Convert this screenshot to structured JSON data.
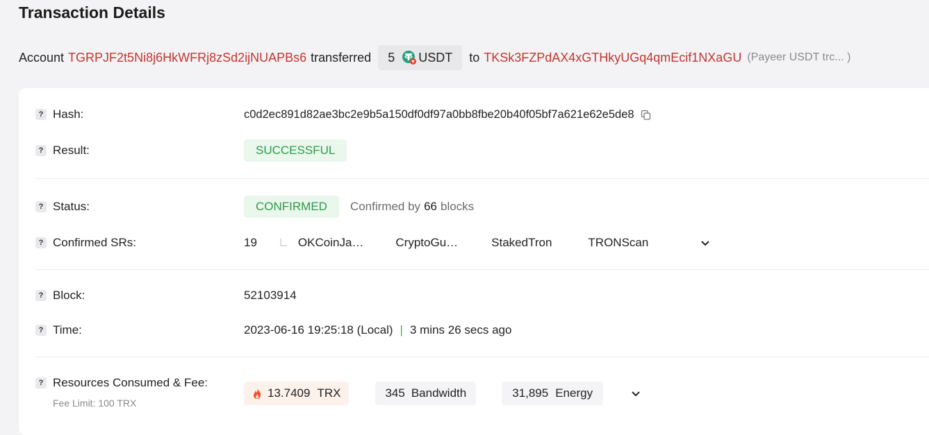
{
  "header": {
    "title": "Transaction Details"
  },
  "summary": {
    "account_label": "Account",
    "from_address": "TGRPJF2t5Ni8j6HkWFRj8zSd2ijNUAPBs6",
    "transferred_label": "transferred",
    "amount": "5",
    "token": "USDT",
    "to_label": "to",
    "to_address": "TKSk3FZPdAX4xGTHkyUGq4qmEcif1NXaGU",
    "to_note": "(Payeer USDT trc... )"
  },
  "details": {
    "hash": {
      "label": "Hash:",
      "value": "c0d2ec891d82ae3bc2e9b5a150df0df97a0bb8fbe20b40f05bf7a621e62e5de8"
    },
    "result": {
      "label": "Result:",
      "value": "SUCCESSFUL"
    },
    "status": {
      "label": "Status:",
      "value": "CONFIRMED",
      "confirmed_prefix": "Confirmed by",
      "confirmed_count": "66",
      "confirmed_suffix": "blocks"
    },
    "confirmed_srs": {
      "label": "Confirmed SRs:",
      "count": "19",
      "items": [
        "OKCoinJa…",
        "CryptoGu…",
        "StakedTron",
        "TRONScan"
      ]
    },
    "block": {
      "label": "Block:",
      "value": "52103914"
    },
    "time": {
      "label": "Time:",
      "value": "2023-06-16 19:25:18 (Local)",
      "separator": "|",
      "relative": "3 mins 26 secs ago"
    },
    "resources": {
      "label": "Resources Consumed & Fee:",
      "fee_limit": "Fee Limit: 100 TRX",
      "fee_value": "13.7409",
      "fee_unit": "TRX",
      "bandwidth_value": "345",
      "bandwidth_unit": "Bandwidth",
      "energy_value": "31,895",
      "energy_unit": "Energy"
    }
  },
  "colors": {
    "address": "#c23631",
    "success_bg": "#e9f7ec",
    "success_text": "#2f9a4a",
    "tether_green": "#26a17b",
    "tron_red": "#eb3e32",
    "fee_fire": "#f0502d"
  },
  "icons": [
    "question-icon",
    "copy-icon",
    "tether-icon",
    "tron-badge-icon",
    "fire-icon",
    "chevron-down-icon"
  ]
}
